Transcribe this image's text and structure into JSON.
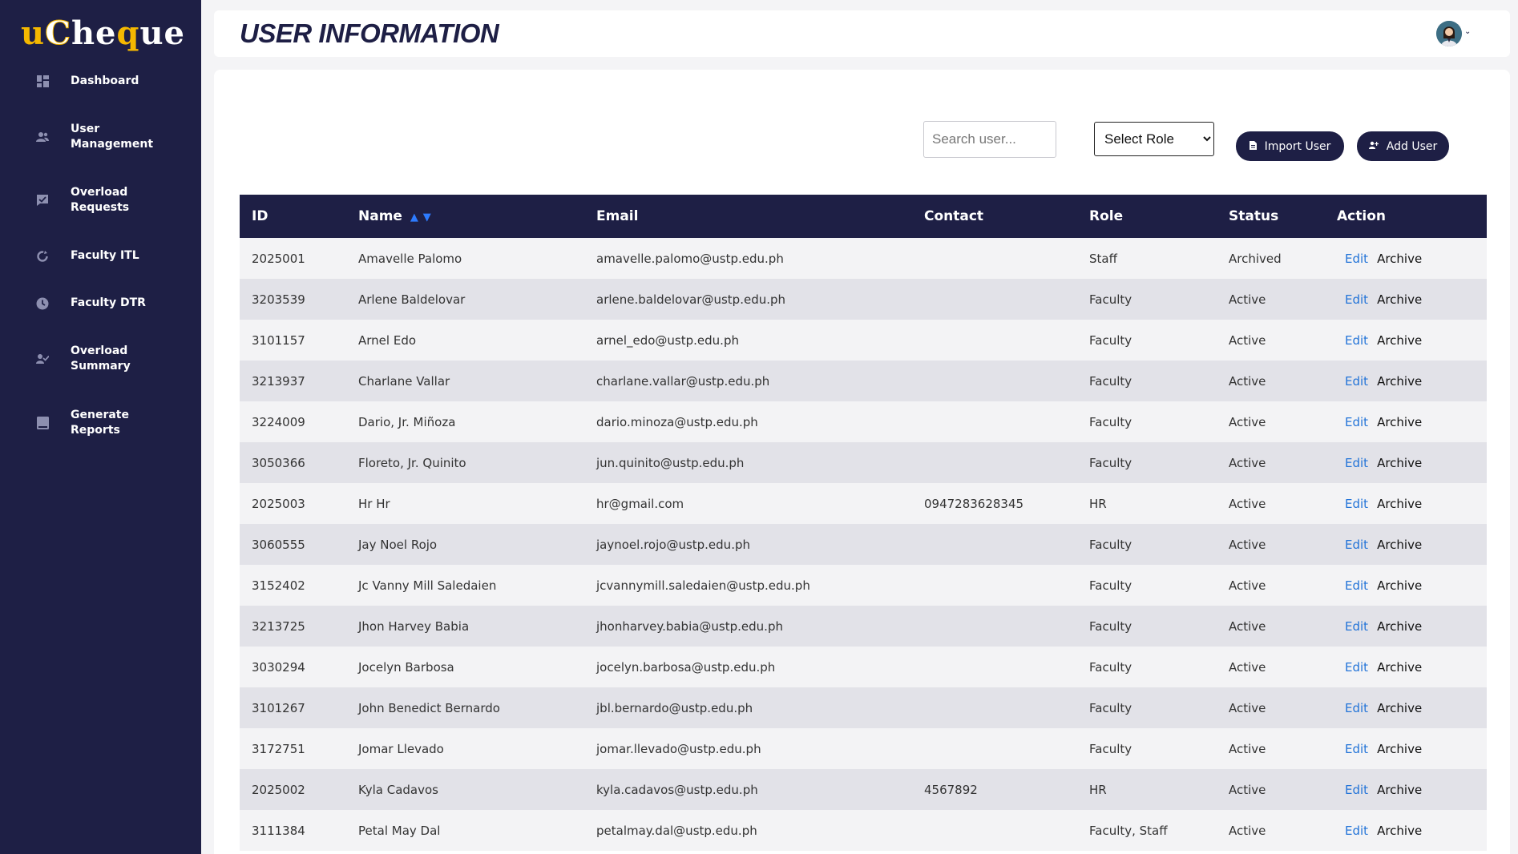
{
  "logo": {
    "part_u": "u",
    "part_c": "C",
    "part_rest1": "he",
    "part_q": "q",
    "part_rest2": "ue"
  },
  "sidebar": {
    "items": [
      {
        "label": "Dashboard",
        "icon": "dashboard-icon"
      },
      {
        "label": "User Management",
        "icon": "users-icon"
      },
      {
        "label": "Overload Requests",
        "icon": "request-icon"
      },
      {
        "label": "Faculty ITL",
        "icon": "refresh-icon"
      },
      {
        "label": "Faculty DTR",
        "icon": "clock-icon"
      },
      {
        "label": "Overload Summary",
        "icon": "user-check-icon"
      },
      {
        "label": "Generate Reports",
        "icon": "report-icon"
      }
    ]
  },
  "header": {
    "title": "USER INFORMATION"
  },
  "toolbar": {
    "search_placeholder": "Search user...",
    "role_options": [
      "Select Role"
    ],
    "import_label": "Import User",
    "add_label": "Add User"
  },
  "table": {
    "headers": [
      "ID",
      "Name",
      "Email",
      "Contact",
      "Role",
      "Status",
      "Action"
    ],
    "sort_up": "▲",
    "sort_down": "▼",
    "edit_label": "Edit",
    "archive_label": "Archive",
    "rows": [
      {
        "id": "2025001",
        "name": "Amavelle Palomo",
        "email": "amavelle.palomo@ustp.edu.ph",
        "contact": "",
        "role": "Staff",
        "status": "Archived"
      },
      {
        "id": "3203539",
        "name": "Arlene Baldelovar",
        "email": "arlene.baldelovar@ustp.edu.ph",
        "contact": "",
        "role": "Faculty",
        "status": "Active"
      },
      {
        "id": "3101157",
        "name": "Arnel Edo",
        "email": "arnel_edo@ustp.edu.ph",
        "contact": "",
        "role": "Faculty",
        "status": "Active"
      },
      {
        "id": "3213937",
        "name": "Charlane Vallar",
        "email": "charlane.vallar@ustp.edu.ph",
        "contact": "",
        "role": "Faculty",
        "status": "Active"
      },
      {
        "id": "3224009",
        "name": "Dario, Jr. Miñoza",
        "email": "dario.minoza@ustp.edu.ph",
        "contact": "",
        "role": "Faculty",
        "status": "Active"
      },
      {
        "id": "3050366",
        "name": "Floreto, Jr. Quinito",
        "email": "jun.quinito@ustp.edu.ph",
        "contact": "",
        "role": "Faculty",
        "status": "Active"
      },
      {
        "id": "2025003",
        "name": "Hr Hr",
        "email": "hr@gmail.com",
        "contact": "0947283628345",
        "role": "HR",
        "status": "Active"
      },
      {
        "id": "3060555",
        "name": "Jay Noel Rojo",
        "email": "jaynoel.rojo@ustp.edu.ph",
        "contact": "",
        "role": "Faculty",
        "status": "Active"
      },
      {
        "id": "3152402",
        "name": "Jc Vanny Mill Saledaien",
        "email": "jcvannymill.saledaien@ustp.edu.ph",
        "contact": "",
        "role": "Faculty",
        "status": "Active"
      },
      {
        "id": "3213725",
        "name": "Jhon Harvey Babia",
        "email": "jhonharvey.babia@ustp.edu.ph",
        "contact": "",
        "role": "Faculty",
        "status": "Active"
      },
      {
        "id": "3030294",
        "name": "Jocelyn Barbosa",
        "email": "jocelyn.barbosa@ustp.edu.ph",
        "contact": "",
        "role": "Faculty",
        "status": "Active"
      },
      {
        "id": "3101267",
        "name": "John Benedict Bernardo",
        "email": "jbl.bernardo@ustp.edu.ph",
        "contact": "",
        "role": "Faculty",
        "status": "Active"
      },
      {
        "id": "3172751",
        "name": "Jomar Llevado",
        "email": "jomar.llevado@ustp.edu.ph",
        "contact": "",
        "role": "Faculty",
        "status": "Active"
      },
      {
        "id": "2025002",
        "name": "Kyla Cadavos",
        "email": "kyla.cadavos@ustp.edu.ph",
        "contact": "4567892",
        "role": "HR",
        "status": "Active"
      },
      {
        "id": "3111384",
        "name": "Petal May Dal",
        "email": "petalmay.dal@ustp.edu.ph",
        "contact": "",
        "role": "Faculty, Staff",
        "status": "Active"
      }
    ]
  },
  "colors": {
    "navy": "#1e1f45",
    "accent": "#f5b800",
    "link": "#2374d8",
    "sort": "#2d7bff"
  }
}
